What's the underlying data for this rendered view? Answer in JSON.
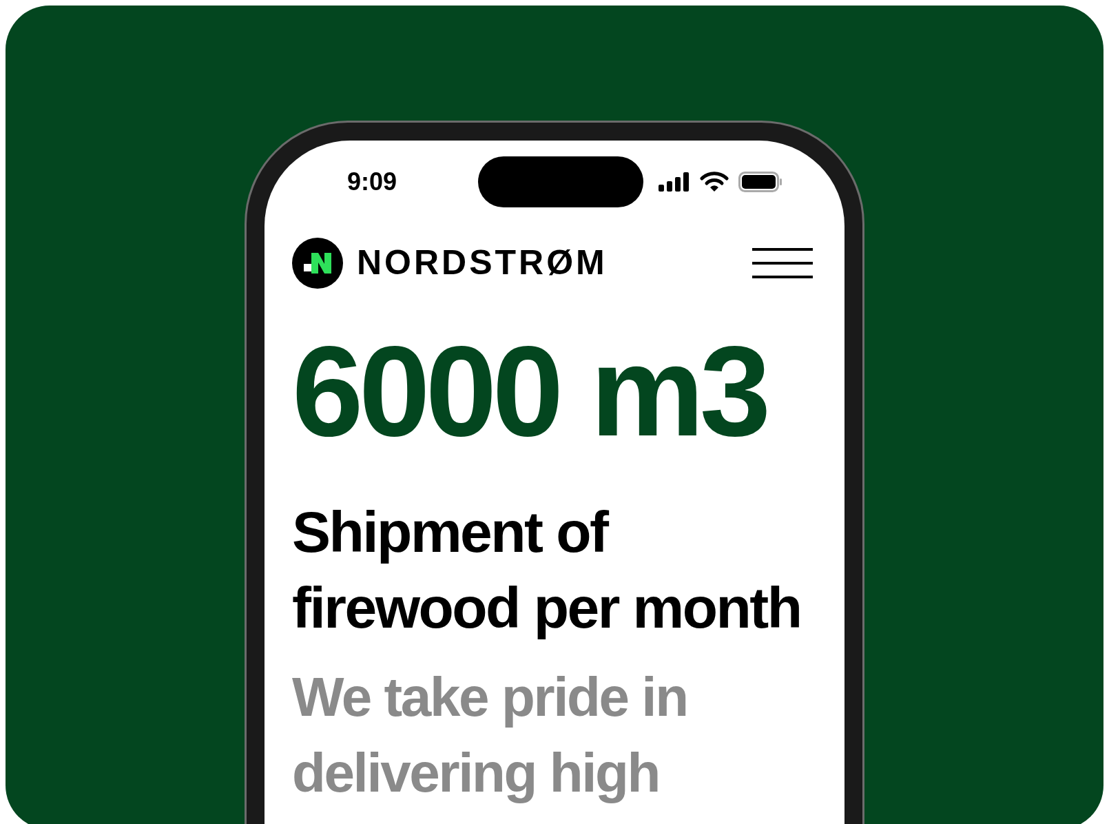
{
  "status_bar": {
    "time": "9:09"
  },
  "header": {
    "brand": "NORDSTRØM"
  },
  "hero": {
    "stat": "6000 m3",
    "heading": "Shipment of firewood per month",
    "description": "We take pride in delivering high"
  }
}
